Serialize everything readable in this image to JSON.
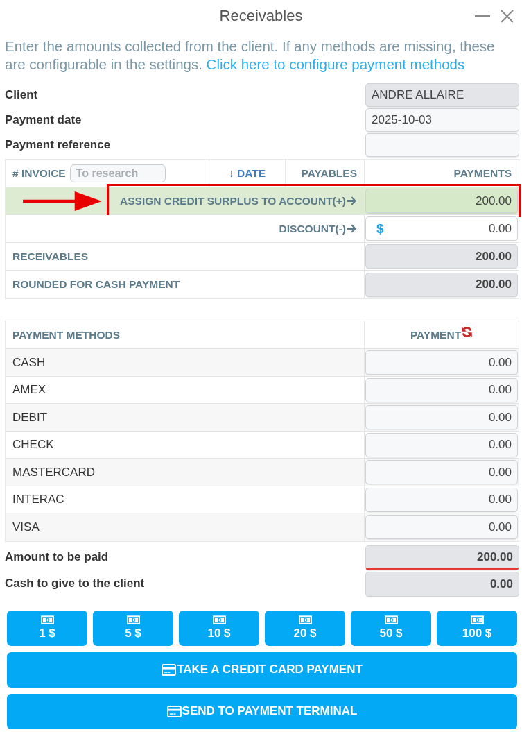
{
  "window": {
    "title": "Receivables"
  },
  "intro": {
    "text": "Enter the amounts collected from the client. If any methods are missing, these are configurable in the settings.",
    "link": "Click here to configure payment methods"
  },
  "fields": [
    {
      "label": "Client",
      "value": "ANDRE ALLAIRE",
      "disabled": true
    },
    {
      "label": "Payment date",
      "value": "2025-10-03",
      "disabled": false
    },
    {
      "label": "Payment reference",
      "disabled": false
    }
  ],
  "invoice_table": {
    "columns": [
      {
        "label": "# INVOICE",
        "kind": "search",
        "placeholder": "To research"
      },
      {
        "label": "↓ DATE",
        "kind": "sort"
      },
      {
        "label": "PAYABLES",
        "kind": "plain"
      },
      {
        "label": "PAYMENTS",
        "kind": "plain"
      }
    ],
    "rows": [
      {
        "kind": "credit",
        "label": "ASSIGN CREDIT SURPLUS TO ACCOUNT(+)",
        "value": "200.00",
        "highlighted": true
      },
      {
        "kind": "discount",
        "label": "DISCOUNT(-)",
        "currency_symbol": "$",
        "value": "0.00",
        "highlighted": false
      },
      {
        "kind": "total",
        "label": "RECEIVABLES",
        "value": "200.00",
        "highlighted": false
      },
      {
        "kind": "total",
        "label": "ROUNDED FOR CASH PAYMENT",
        "value": "200.00",
        "highlighted": false
      }
    ]
  },
  "methods_table": {
    "columns": [
      "PAYMENT METHODS",
      "PAYMENT"
    ],
    "rows": [
      {
        "name": "CASH",
        "value": "0.00"
      },
      {
        "name": "AMEX",
        "value": "0.00"
      },
      {
        "name": "DEBIT",
        "value": "0.00"
      },
      {
        "name": "CHECK",
        "value": "0.00"
      },
      {
        "name": "MASTERCARD",
        "value": "0.00"
      },
      {
        "name": "INTERAC",
        "value": "0.00"
      },
      {
        "name": "VISA",
        "value": "0.00"
      }
    ]
  },
  "totals": [
    {
      "label": "Amount to be paid",
      "value": "200.00",
      "invalid": true
    },
    {
      "label": "Cash to give to the client",
      "value": "0.00",
      "invalid": false
    }
  ],
  "cash_buttons": [
    "1 $",
    "5 $",
    "10 $",
    "20 $",
    "50 $",
    "100 $"
  ],
  "actions": [
    {
      "label": "TAKE A CREDIT CARD PAYMENT"
    },
    {
      "label": "SEND TO PAYMENT TERMINAL"
    }
  ]
}
